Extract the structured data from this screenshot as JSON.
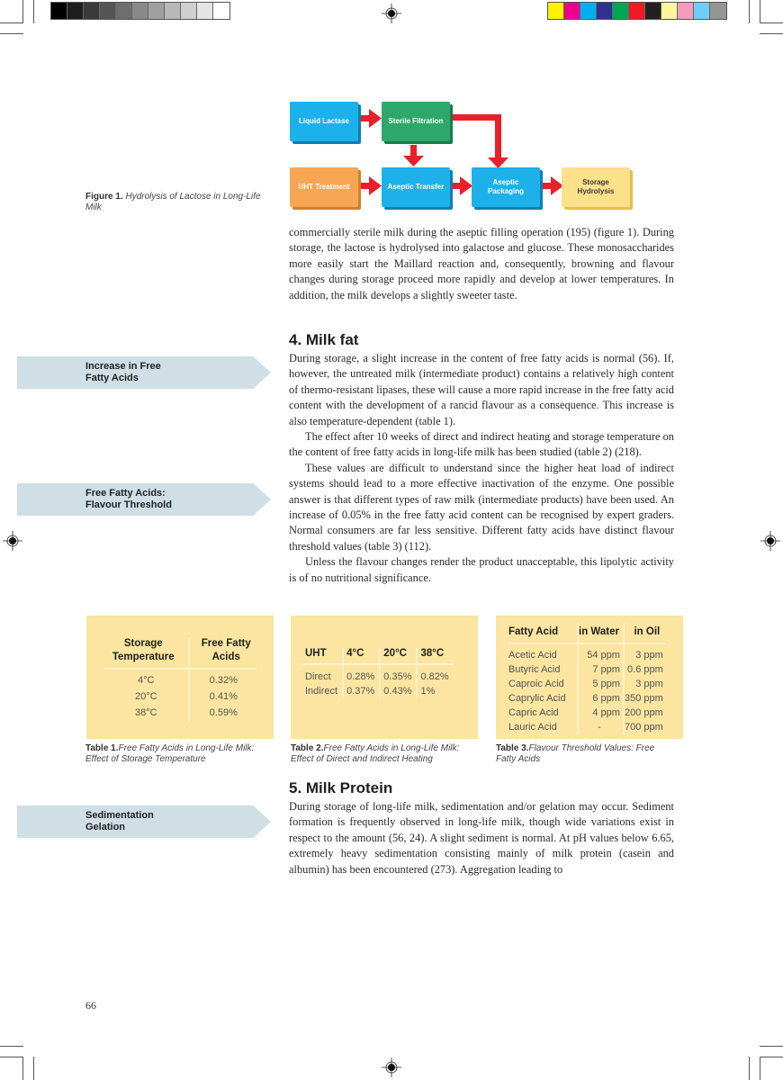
{
  "print_marks": {
    "grayscale_swatches": [
      "#000000",
      "#1e1e1e",
      "#3a3a3a",
      "#555555",
      "#6e6e6e",
      "#888888",
      "#a0a0a0",
      "#b8b8b8",
      "#cfcfcf",
      "#e4e4e4",
      "#ffffff"
    ],
    "color_swatches": [
      "#fff200",
      "#ec008c",
      "#00aeef",
      "#2e3192",
      "#00a651",
      "#ed1c24",
      "#231f20",
      "#fff799",
      "#f49ac1",
      "#6dcff6",
      "#959595"
    ]
  },
  "figure1": {
    "boxes": [
      {
        "id": "liquid-lactase",
        "label": "Liquid Lactase",
        "color": "blue"
      },
      {
        "id": "sterile-filtration",
        "label": "Sterile Filtration",
        "color": "green"
      },
      {
        "id": "uht-treatment",
        "label": "UHT Treatment",
        "color": "orange"
      },
      {
        "id": "aseptic-transfer",
        "label": "Aseptic Transfer",
        "color": "blue"
      },
      {
        "id": "aseptic-packaging",
        "label": "Aseptic Packaging",
        "color": "blue"
      },
      {
        "id": "storage-hydrolysis",
        "label": "Storage Hydrolysis",
        "color": "yellow"
      }
    ],
    "arrow_color": "#e8202a",
    "caption_label": "Figure 1.",
    "caption_text": "Hydrolysis of Lactose in Long-Life Milk"
  },
  "intro_paragraph": "commercially sterile milk during the aseptic filling operation (195) (figure 1). During storage, the lactose is hydrolysed into galactose and glucose. These monosaccharides more easily start the Maillard reaction and, consequently, browning and flavour changes during storage proceed more rapidly and develop at lower temperatures. In addition, the milk develops a slightly sweeter taste.",
  "section4": {
    "heading": "4. Milk fat",
    "paragraphs": [
      "During storage, a slight increase in the content of free fatty acids is normal (56). If, however, the untreated milk (intermediate product) contains a relatively high content of thermo-resistant lipases, these will cause a more rapid increase in the free fatty acid content with the development of a rancid flavour as a consequence. This increase is also temperature-dependent (table 1).",
      "The effect after 10 weeks of direct and indirect heating and storage temperature on the content of free fatty acids in long-life milk has been studied (table 2) (218).",
      "These values are difficult to understand since the higher heat load of indirect systems should lead to a more effective inactivation of the enzyme. One possible answer is that different types of raw milk (intermediate products) have been used. An increase of 0.05% in the free fatty acid content can be recognised by expert graders. Normal consumers are far less sensitive. Different fatty acids have distinct flavour threshold values (table 3) (112).",
      "Unless the flavour changes render the product unacceptable, this lipolytic activity is of no nutritional significance."
    ]
  },
  "side_tags": [
    {
      "line1": "Increase in Free",
      "line2": "Fatty Acids"
    },
    {
      "line1": "Free Fatty Acids:",
      "line2": "Flavour Threshold"
    },
    {
      "line1": "Sedimentation",
      "line2": "Gelation"
    }
  ],
  "table1": {
    "headers": [
      [
        "Storage",
        "Temperature"
      ],
      [
        "Free Fatty",
        "Acids"
      ]
    ],
    "rows": [
      [
        "4°C",
        "0.32%"
      ],
      [
        "20°C",
        "0.41%"
      ],
      [
        "38°C",
        "0.59%"
      ]
    ],
    "caption_label": "Table 1.",
    "caption_text": "Free Fatty Acids in Long-Life Milk: Effect of Storage Temperature"
  },
  "table2": {
    "headers": [
      "UHT",
      "4°C",
      "20°C",
      "38°C"
    ],
    "rows": [
      [
        "Direct",
        "0.28%",
        "0.35%",
        "0.82%"
      ],
      [
        "Indirect",
        "0.37%",
        "0.43%",
        "1%"
      ]
    ],
    "caption_label": "Table 2.",
    "caption_text": "Free Fatty Acids in Long-Life Milk: Effect of Direct and Indirect Heating"
  },
  "table3": {
    "headers": [
      "Fatty Acid",
      "in Water",
      "in Oil"
    ],
    "rows": [
      [
        "Acetic Acid",
        "54 ppm",
        "3 ppm"
      ],
      [
        "Butyric Acid",
        "7 ppm",
        "0.6 ppm"
      ],
      [
        "Caproic Acid",
        "5 ppm",
        "3 ppm"
      ],
      [
        "Caprylic Acid",
        "6 ppm",
        "350 ppm"
      ],
      [
        "Capric Acid",
        "4 ppm",
        "200 ppm"
      ],
      [
        "Lauric Acid",
        "-",
        "700 ppm"
      ]
    ],
    "caption_label": "Table 3.",
    "caption_text": "Flavour Threshold Values: Free Fatty Acids"
  },
  "section5": {
    "heading": "5. Milk Protein",
    "paragraph": "During storage of long-life milk, sedimentation and/or gelation may occur. Sediment formation is frequently observed in long-life milk, though wide variations exist in respect to the amount (56, 24). A slight sediment is normal. At pH values below 6.65, extremely heavy sedimentation consisting mainly of milk protein (casein and albumin) has been encountered (273). Aggregation leading to"
  },
  "page_number": "66"
}
